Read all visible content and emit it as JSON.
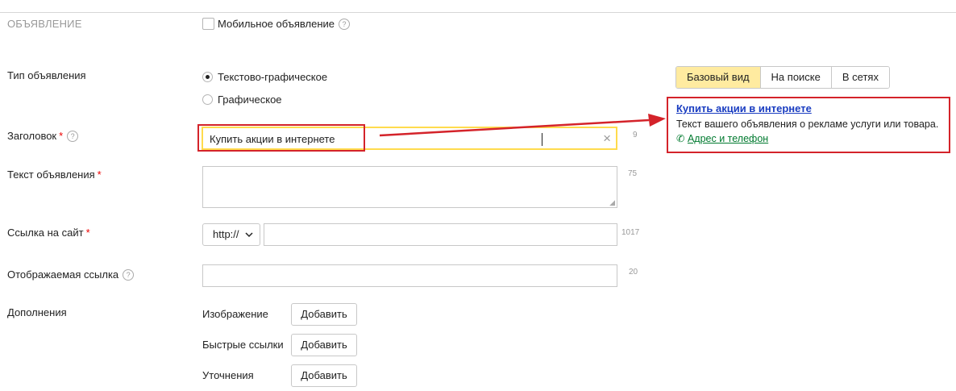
{
  "section": {
    "title": "ОБЪЯВЛЕНИЕ"
  },
  "mobile": {
    "label": "Мобильное объявление",
    "checked": false
  },
  "ad_type": {
    "label": "Тип объявления",
    "options": [
      {
        "label": "Текстово-графическое",
        "selected": true
      },
      {
        "label": "Графическое",
        "selected": false
      }
    ]
  },
  "headline": {
    "label": "Заголовок",
    "required": "*",
    "value": "Купить акции в интернете",
    "counter": "9",
    "clear_glyph": "×"
  },
  "ad_text": {
    "label": "Текст объявления",
    "required": "*",
    "value": "",
    "counter": "75"
  },
  "site_link": {
    "label": "Ссылка на сайт",
    "required": "*",
    "protocol": "http://",
    "value": "",
    "counter": "1017"
  },
  "display_link": {
    "label": "Отображаемая ссылка",
    "value": "",
    "counter": "20"
  },
  "extras": {
    "label": "Дополнения",
    "items": [
      {
        "label": "Изображение",
        "button": "Добавить"
      },
      {
        "label": "Быстрые ссылки",
        "button": "Добавить"
      },
      {
        "label": "Уточнения",
        "button": "Добавить"
      }
    ]
  },
  "preview": {
    "tabs": [
      {
        "label": "Базовый вид",
        "active": true
      },
      {
        "label": "На поиске",
        "active": false
      },
      {
        "label": "В сетях",
        "active": false
      }
    ],
    "title": "Купить акции в интернете",
    "text": "Текст вашего объявления о рекламе услуги или товара.",
    "contact_link": "Адрес и телефон"
  },
  "colors": {
    "highlight_red": "#d4232a",
    "input_focus_yellow": "#ffdb4d",
    "active_tab": "#ffeba0",
    "link_blue": "#1a3dc1",
    "link_green": "#007a2f"
  },
  "icons": {
    "help": "?",
    "phone": "✆"
  }
}
